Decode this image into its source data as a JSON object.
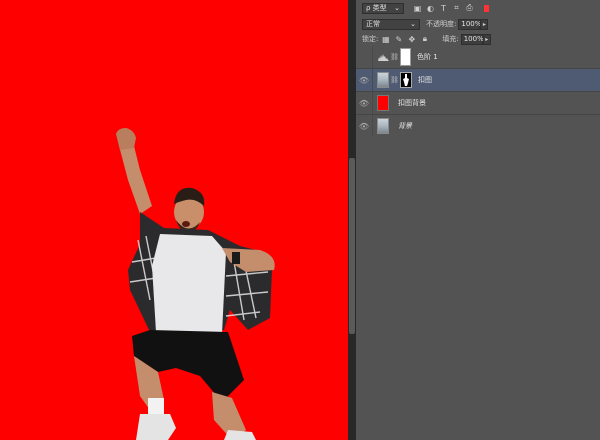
{
  "canvas": {
    "background_color": "#ff0000"
  },
  "layers_panel": {
    "filter_type_label": "ρ 类型",
    "blend_mode": "正常",
    "opacity_label": "不透明度:",
    "opacity_value": "100%",
    "lock_label": "锁定:",
    "fill_label": "填充:",
    "fill_value": "100%",
    "accent_color": "#ff3333",
    "selected_row_color": "#4f5b72",
    "layers": [
      {
        "name": "色阶 1",
        "kind": "adjustment",
        "visible": false
      },
      {
        "name": "扣图",
        "kind": "masked-photo",
        "visible": true,
        "selected": true
      },
      {
        "name": "扣图背景",
        "kind": "solid-red",
        "visible": true
      },
      {
        "name": "背景",
        "kind": "photo",
        "visible": true,
        "italic": true
      }
    ]
  }
}
